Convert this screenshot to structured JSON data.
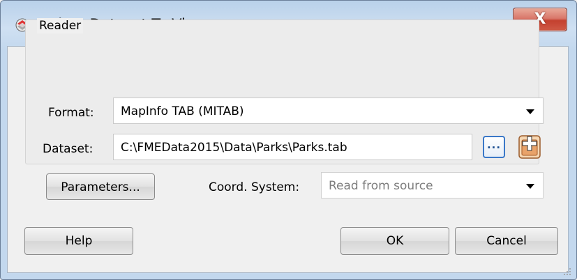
{
  "window": {
    "title": "Select Dataset To View",
    "close_glyph": "X",
    "accent_color": "#c4402f"
  },
  "reader": {
    "group_label": "Reader",
    "format": {
      "label": "Format:",
      "value": "MapInfo TAB (MITAB)"
    },
    "dataset": {
      "label": "Dataset:",
      "value": "C:\\FMEData2015\\Data\\Parks\\Parks.tab",
      "browse_label": "..."
    },
    "parameters_label": "Parameters...",
    "coord_system": {
      "label": "Coord. System:",
      "value": "Read from source"
    }
  },
  "footer": {
    "help_label": "Help",
    "ok_label": "OK",
    "cancel_label": "Cancel"
  },
  "icons": {
    "app": "fme-workbench-icon",
    "add": "add-dataset-icon",
    "resize": "resize-grip-icon"
  }
}
